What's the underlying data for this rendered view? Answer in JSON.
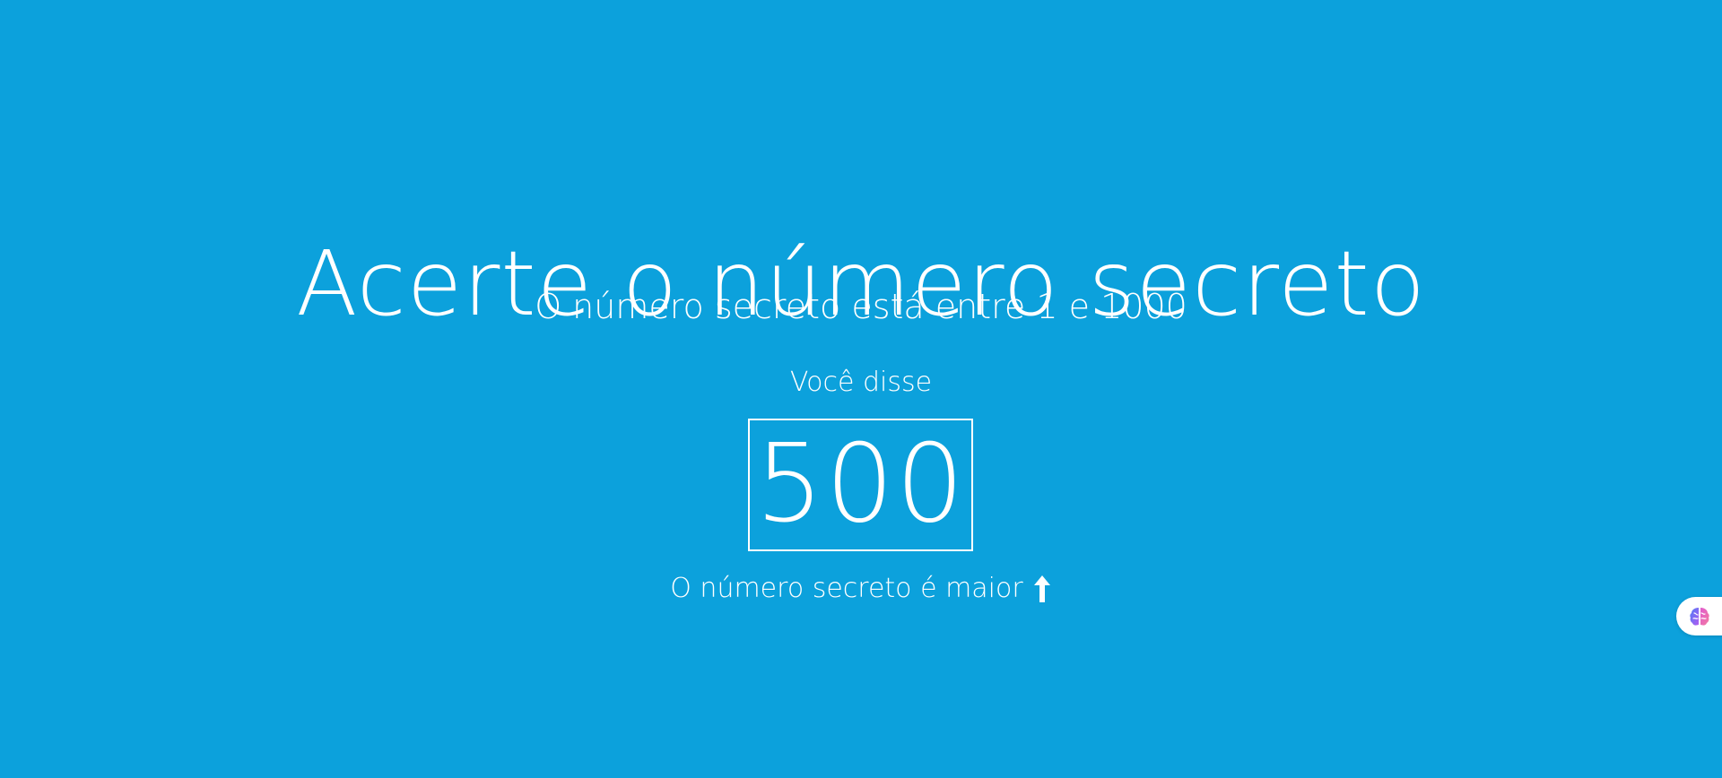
{
  "game": {
    "title": "Acerte o número secreto",
    "subtitle": "O número secreto está entre 1 e 1000",
    "said_label": "Você disse",
    "guess": "500",
    "hint": "O número secreto é maior",
    "hint_icon": "arrow-up-icon"
  },
  "widget": {
    "icon": "brain-icon"
  },
  "colors": {
    "background": "#0ca1dc",
    "text": "#ffffff"
  }
}
